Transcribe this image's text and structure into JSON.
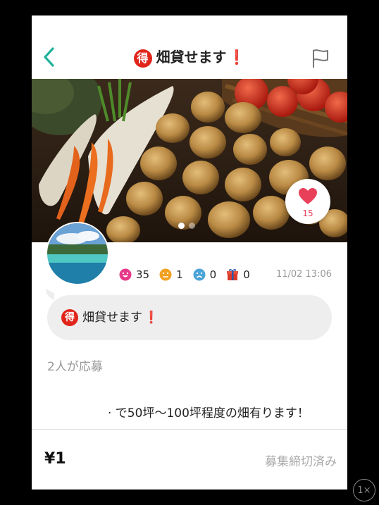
{
  "header": {
    "toku_badge": "得",
    "title": "畑貸せます",
    "exclaim": "❗"
  },
  "icons": {
    "back": "chevron-left-icon",
    "report": "flag-icon",
    "like": "heart-icon"
  },
  "colors": {
    "accent": "#1fb39a",
    "badge_red": "#e0251b",
    "heart": "#e8405a"
  },
  "photo": {
    "slide_count": 2,
    "active_slide": 1
  },
  "like": {
    "count": "15"
  },
  "stats": [
    {
      "icon": "smile-emoji-icon",
      "count": "35"
    },
    {
      "icon": "neutral-emoji-icon",
      "count": "1"
    },
    {
      "icon": "sad-emoji-icon",
      "count": "0"
    },
    {
      "icon": "gift-box-icon",
      "count": "0"
    }
  ],
  "timestamp": "11/02 13:06",
  "bubble": {
    "toku_badge": "得",
    "text": "畑貸せます",
    "exclaim": "❗"
  },
  "applicants": "2人が応募",
  "description": "· で50坪〜100坪程度の畑有ります！",
  "footer": {
    "price": "¥1",
    "status": "募集締切済み"
  },
  "zoom": "1×"
}
